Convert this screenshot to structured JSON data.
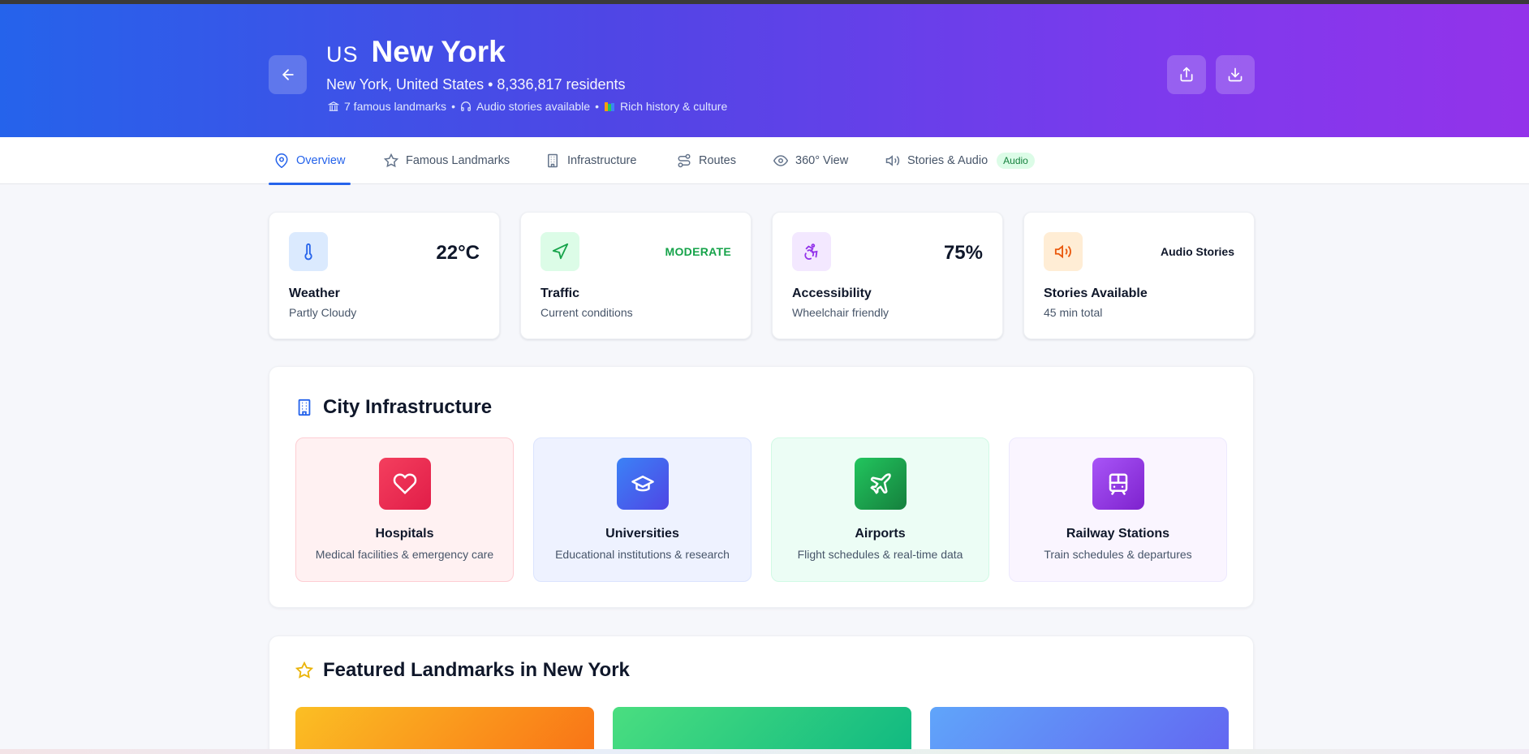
{
  "header": {
    "country_code": "US",
    "city": "New York",
    "subtitle": "New York, United States • 8,336,817 residents",
    "meta": [
      {
        "icon": "landmark-icon",
        "text": "7 famous landmarks"
      },
      {
        "icon": "headphones-icon",
        "text": "Audio stories available"
      },
      {
        "icon": "books-icon",
        "text": "Rich history & culture"
      }
    ],
    "separator": "•"
  },
  "tabs": [
    {
      "label": "Overview",
      "icon": "map-pin-icon",
      "active": true
    },
    {
      "label": "Famous Landmarks",
      "icon": "star-icon"
    },
    {
      "label": "Infrastructure",
      "icon": "building-icon"
    },
    {
      "label": "Routes",
      "icon": "route-icon"
    },
    {
      "label": "360° View",
      "icon": "eye-icon"
    },
    {
      "label": "Stories & Audio",
      "icon": "volume-icon",
      "badge": "Audio"
    }
  ],
  "stats": [
    {
      "icon": "thermometer-icon",
      "value": "22°C",
      "label": "Weather",
      "sub": "Partly Cloudy",
      "color": "#2563eb"
    },
    {
      "icon": "navigation-icon",
      "value": "MODERATE",
      "label": "Traffic",
      "sub": "Current conditions",
      "color": "#16a34a"
    },
    {
      "icon": "accessibility-icon",
      "value": "75%",
      "label": "Accessibility",
      "sub": "Wheelchair friendly",
      "color": "#9333ea"
    },
    {
      "icon": "volume-icon",
      "value": "Audio Stories",
      "label": "Stories Available",
      "sub": "45 min total",
      "color": "#ea580c"
    }
  ],
  "infrastructure": {
    "title": "City Infrastructure",
    "items": [
      {
        "icon": "heart-icon",
        "name": "Hospitals",
        "desc": "Medical facilities & emergency care",
        "color": "#e11d48"
      },
      {
        "icon": "graduation-cap-icon",
        "name": "Universities",
        "desc": "Educational institutions & research",
        "color": "#4f46e5"
      },
      {
        "icon": "plane-icon",
        "name": "Airports",
        "desc": "Flight schedules & real-time data",
        "color": "#16a34a"
      },
      {
        "icon": "train-icon",
        "name": "Railway Stations",
        "desc": "Train schedules & departures",
        "color": "#9333ea"
      }
    ]
  },
  "featured": {
    "title": "Featured Landmarks in New York"
  }
}
